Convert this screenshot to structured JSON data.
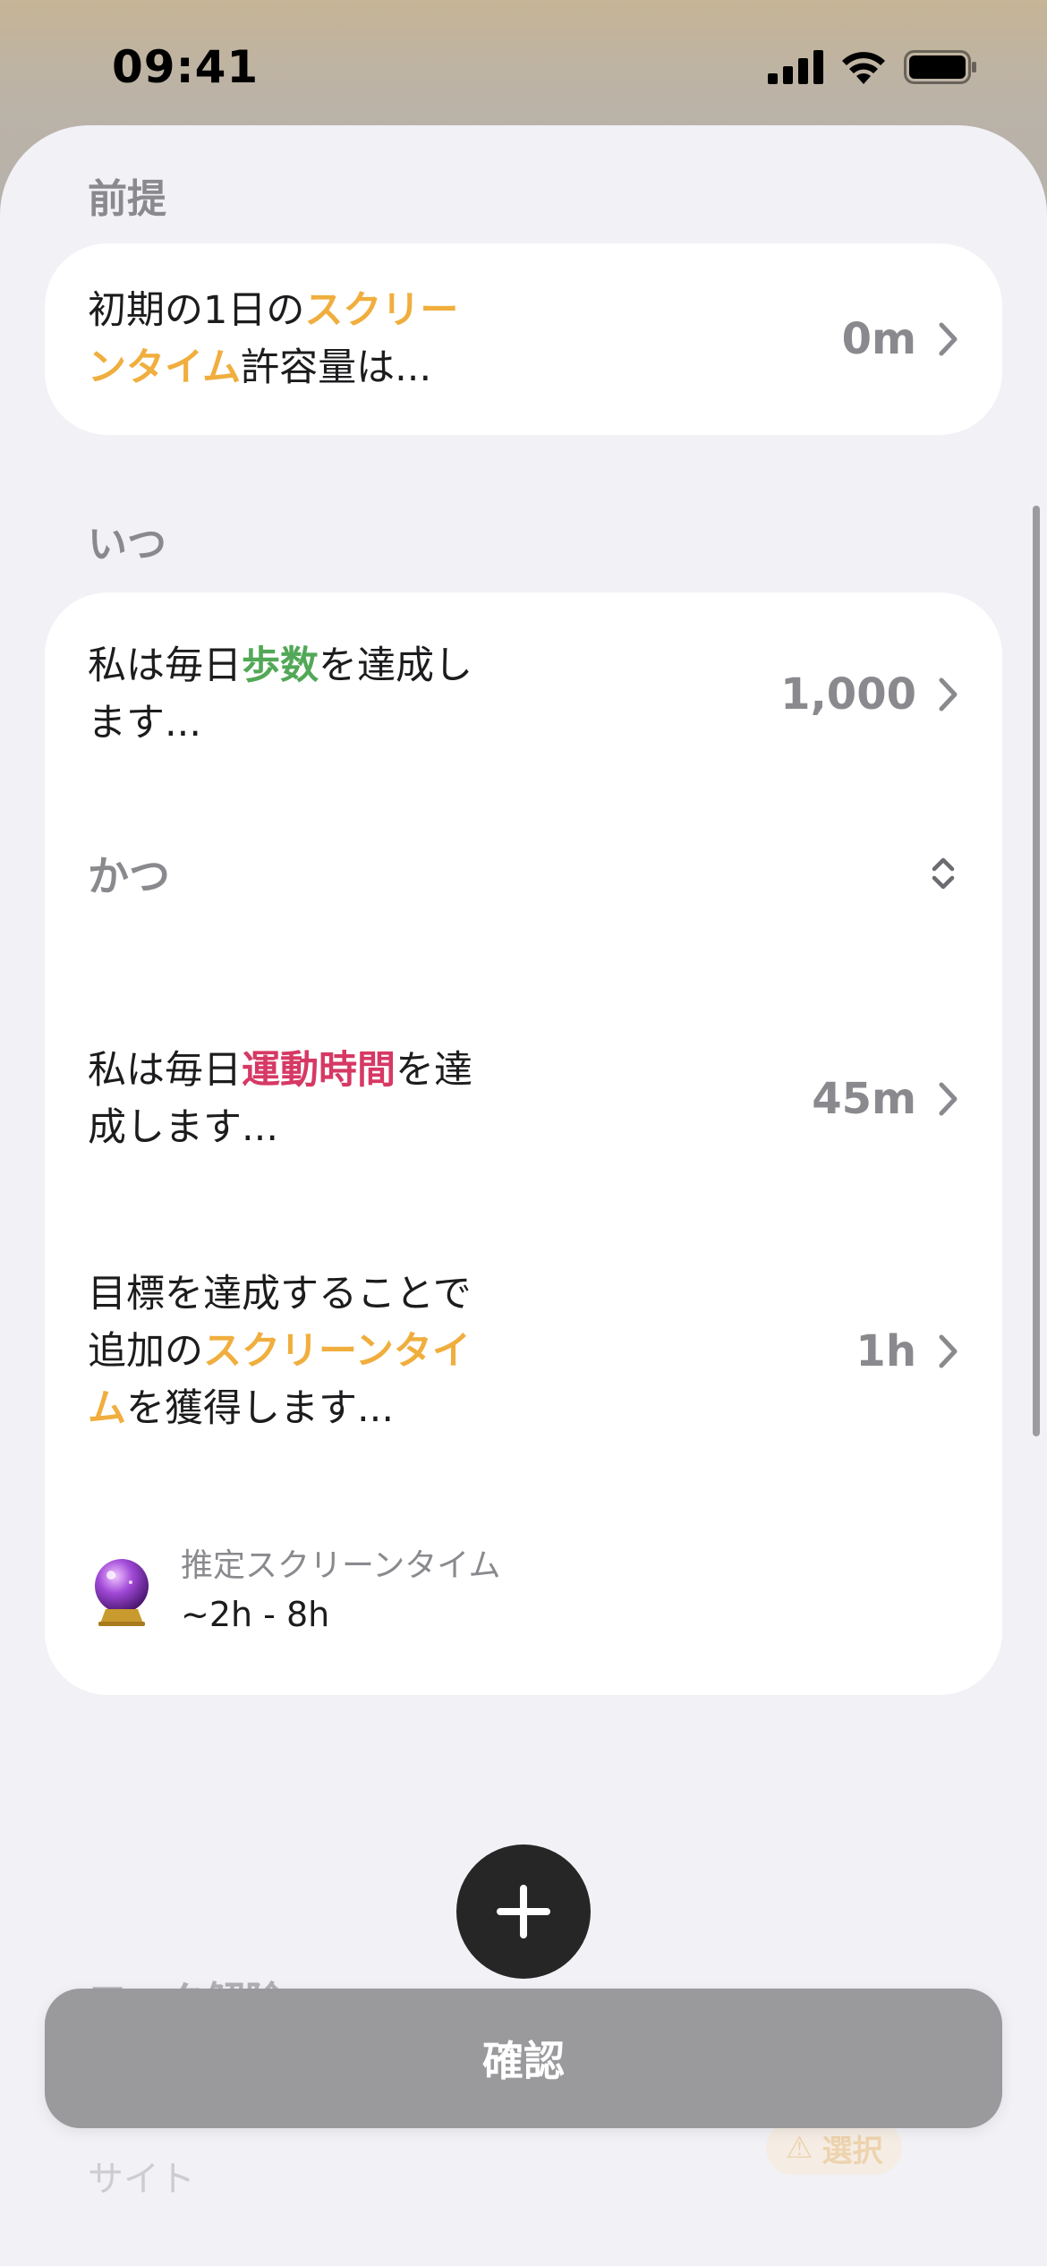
{
  "status_bar": {
    "time": "09:41"
  },
  "premise": {
    "section_label": "前提",
    "text_prefix": "初期の1日の",
    "text_highlight": "スクリーンタイム",
    "text_suffix": "許容量は...",
    "value": "0m"
  },
  "when": {
    "section_label": "いつ",
    "steps_prefix": "私は毎日",
    "steps_highlight": "歩数",
    "steps_suffix": "を達成します...",
    "steps_value": "1,000",
    "conjunction": "かつ",
    "exercise_prefix": "私は毎日",
    "exercise_highlight": "運動時間",
    "exercise_suffix": "を達成します...",
    "exercise_value": "45m",
    "reward_prefix": "目標を達成することで追加の",
    "reward_highlight": "スクリーンタイム",
    "reward_suffix": "を獲得します...",
    "reward_value": "1h",
    "estimate_label": "推定スクリーンタイム",
    "estimate_value": "~2h - 8h"
  },
  "below_fold": {
    "section_label": "ロック解除",
    "item_sub": "サイト",
    "badge": "選択"
  },
  "confirm_label": "確認",
  "colors": {
    "accent_orange": "#f0ae3e",
    "accent_green": "#52a857",
    "accent_pink": "#d63964"
  }
}
